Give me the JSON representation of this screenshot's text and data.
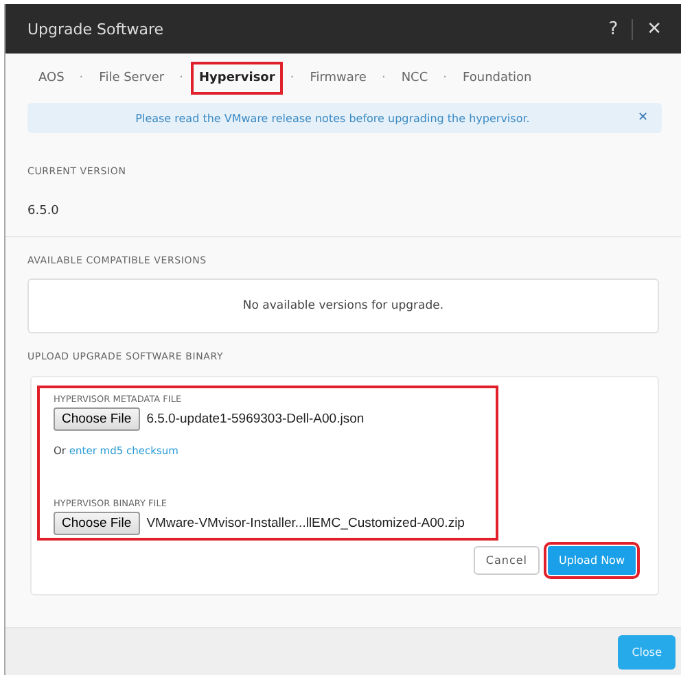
{
  "window": {
    "title": "Upgrade Software",
    "help": "?",
    "close": "✕"
  },
  "tabs": [
    {
      "label": "AOS",
      "selected": false,
      "highlighted": false
    },
    {
      "label": "File Server",
      "selected": false,
      "highlighted": false
    },
    {
      "label": "Hypervisor",
      "selected": true,
      "highlighted": true
    },
    {
      "label": "Firmware",
      "selected": false,
      "highlighted": false
    },
    {
      "label": "NCC",
      "selected": false,
      "highlighted": false
    },
    {
      "label": "Foundation",
      "selected": false,
      "highlighted": false
    }
  ],
  "tab_separator": "·",
  "banner": {
    "text": "Please read the VMware release notes before upgrading the hypervisor.",
    "close": "✕"
  },
  "current_version": {
    "label": "CURRENT VERSION",
    "value": "6.5.0"
  },
  "available_versions": {
    "label": "AVAILABLE COMPATIBLE VERSIONS",
    "empty_text": "No available versions for upgrade."
  },
  "upload": {
    "label": "UPLOAD UPGRADE SOFTWARE BINARY",
    "highlighted": true,
    "files": [
      {
        "label": "HYPERVISOR METADATA FILE",
        "button": "Choose File",
        "file_name": "6.5.0-update1-5969303-Dell-A00.json",
        "alt_prefix": "Or",
        "alt_link": "enter md5 checksum"
      },
      {
        "label": "HYPERVISOR BINARY FILE",
        "button": "Choose File",
        "file_name": "VMware-VMvisor-Installer...llEMC_Customized-A00.zip"
      }
    ],
    "cancel": "Cancel",
    "submit": {
      "label": "Upload Now",
      "highlighted": true
    }
  },
  "footer": {
    "close": "Close"
  }
}
